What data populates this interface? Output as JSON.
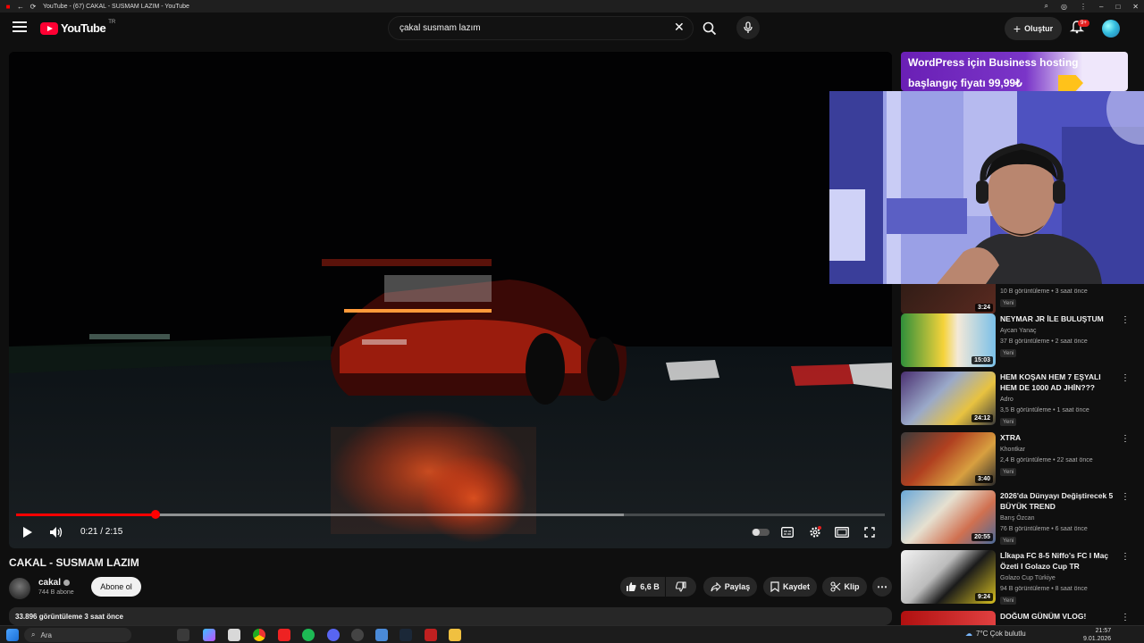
{
  "browser": {
    "tab_title": "YouTube - (67) CAKAL - SUSMAM LAZIM - YouTube"
  },
  "header": {
    "logo_text": "YouTube",
    "country_code": "TR",
    "search_value": "çakal susmam lazım",
    "create_label": "Oluştur",
    "notification_count": "9+"
  },
  "player": {
    "time_current": "0:21",
    "time_total": "2:15",
    "time_display": "0:21 / 2:15",
    "progress_played": 0.16,
    "progress_loaded": 0.7
  },
  "video": {
    "title": "CAKAL - SUSMAM LAZIM",
    "channel_name": "cakal",
    "subscribers": "744 B abone",
    "subscribe_label": "Abone ol",
    "like_count": "6,6 B",
    "share_label": "Paylaş",
    "save_label": "Kaydet",
    "clip_label": "Klip",
    "views_and_date": "33.896 görüntüleme  3 saat önce"
  },
  "ad": {
    "line1": "WordPress için Business hosting",
    "line2": "başlangıç fiyatı 99,99₺"
  },
  "recommendations": [
    {
      "title": "",
      "channel": "",
      "meta": "10 B görüntüleme • 3 saat önce",
      "duration": "3:24",
      "badge": "Yeni"
    },
    {
      "title": "NEYMAR JR İLE BULUŞTUM",
      "channel": "Aycan Yanaç",
      "meta": "37 B görüntüleme • 2 saat önce",
      "duration": "15:03",
      "badge": "Yeni"
    },
    {
      "title": "HEM KOŞAN HEM 7 EŞYALI HEM DE 1000 AD JHİN???",
      "channel": "Adro",
      "meta": "3,5 B görüntüleme • 1 saat önce",
      "duration": "24:12",
      "badge": "Yeni"
    },
    {
      "title": "XTRA",
      "channel": "Khontkar",
      "meta": "2,4 B görüntüleme • 22 saat önce",
      "duration": "3:40",
      "badge": "Yeni"
    },
    {
      "title": "2026'da Dünyayı Değiştirecek 5 BÜYÜK TREND",
      "channel": "Barış Özcan",
      "meta": "76 B görüntüleme • 6 saat önce",
      "duration": "20:55",
      "badge": "Yeni"
    },
    {
      "title": "Lİkapa FC 8-5 Niffo's FC I Maç Özeti I Golazo Cup TR",
      "channel": "Golazo Cup Türkiye",
      "meta": "94 B görüntüleme • 8 saat önce",
      "duration": "9:24",
      "badge": "Yeni"
    },
    {
      "title": "DOĞUM GÜNÜM VLOG!",
      "channel": "",
      "meta": "",
      "duration": "",
      "badge": ""
    }
  ],
  "taskbar": {
    "search_placeholder": "Ara",
    "weather": "7°C  Çok bulutlu",
    "time": "21:57",
    "date": "9.01.2026"
  }
}
